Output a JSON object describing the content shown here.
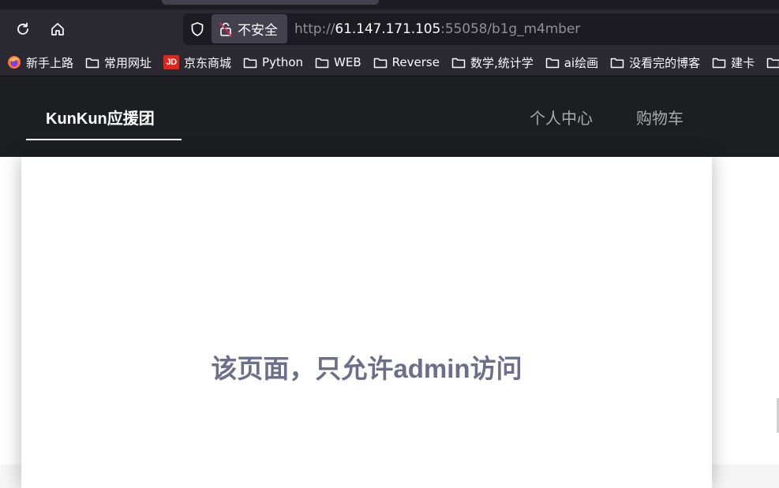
{
  "browser": {
    "security_label": "不安全",
    "url": {
      "scheme": "http://",
      "host": "61.147.171.105",
      "rest": ":55058/b1g_m4mber"
    },
    "bookmarks": [
      {
        "label": "新手上路",
        "icon": "firefox-icon"
      },
      {
        "label": "常用网址",
        "icon": "folder-icon"
      },
      {
        "label": "京东商城",
        "icon": "jd-icon",
        "icon_text": "JD"
      },
      {
        "label": "Python",
        "icon": "folder-icon"
      },
      {
        "label": "WEB",
        "icon": "folder-icon"
      },
      {
        "label": "Reverse",
        "icon": "folder-icon"
      },
      {
        "label": "数学,统计学",
        "icon": "folder-icon"
      },
      {
        "label": "ai绘画",
        "icon": "folder-icon"
      },
      {
        "label": "没看完的博客",
        "icon": "folder-icon"
      },
      {
        "label": "建卡",
        "icon": "folder-icon"
      },
      {
        "label": "",
        "icon": "folder-icon"
      }
    ]
  },
  "site": {
    "brand": "KunKun应援团",
    "nav": {
      "profile": "个人中心",
      "cart": "购物车"
    },
    "message": "该页面，只允许admin访问"
  },
  "colors": {
    "chrome_bg": "#2b2a33",
    "urlbar_bg": "#1c1b22",
    "header_bg": "#1d1e22",
    "message_color": "#6b6f8a",
    "jd_red": "#e1251b"
  }
}
